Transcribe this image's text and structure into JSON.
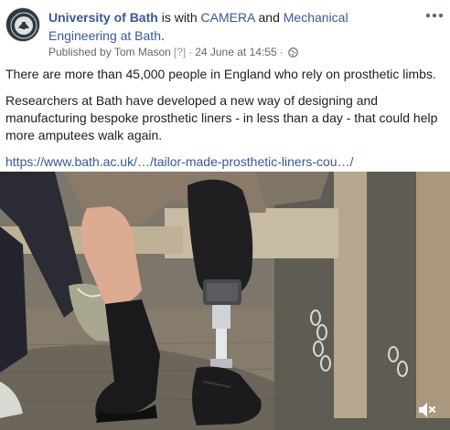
{
  "post": {
    "page_name": "University of Bath",
    "with_text": "is with",
    "tagged_1": "CAMERA",
    "and_text": "and",
    "tagged_2": "Mechanical Engineering at Bath",
    "title_end": ".",
    "published_by": "Published by Tom Mason",
    "question_mark": "[?]",
    "date_sep": "·",
    "date": "24 June at 14:55",
    "date_sep2": "·",
    "privacy_icon": "globe-icon",
    "more_icon": "more-options-icon",
    "paragraph_1": "There are more than 45,000 people in England who rely on prosthetic limbs.",
    "paragraph_2": "Researchers at Bath have developed a new way of designing and manufacturing bespoke prosthetic liners - in less than a day - that could help more amputees walk again.",
    "link": "https://www.bath.ac.uk/…/tailor-made-prosthetic-liners-cou…/"
  },
  "video": {
    "mute_icon": "speaker-mute-icon",
    "colors": {
      "ground": "#7a7468",
      "bench": "#a89c86",
      "shadow": "#3a3934",
      "skin": "#d9a98f",
      "socket": "#1f1f21",
      "metal": "#cfd3d6",
      "shoe": "#1b1b1d",
      "jeans": "#2b2c36"
    }
  },
  "colors": {
    "link": "#385898",
    "text": "#1c1e21",
    "meta": "#616770"
  }
}
